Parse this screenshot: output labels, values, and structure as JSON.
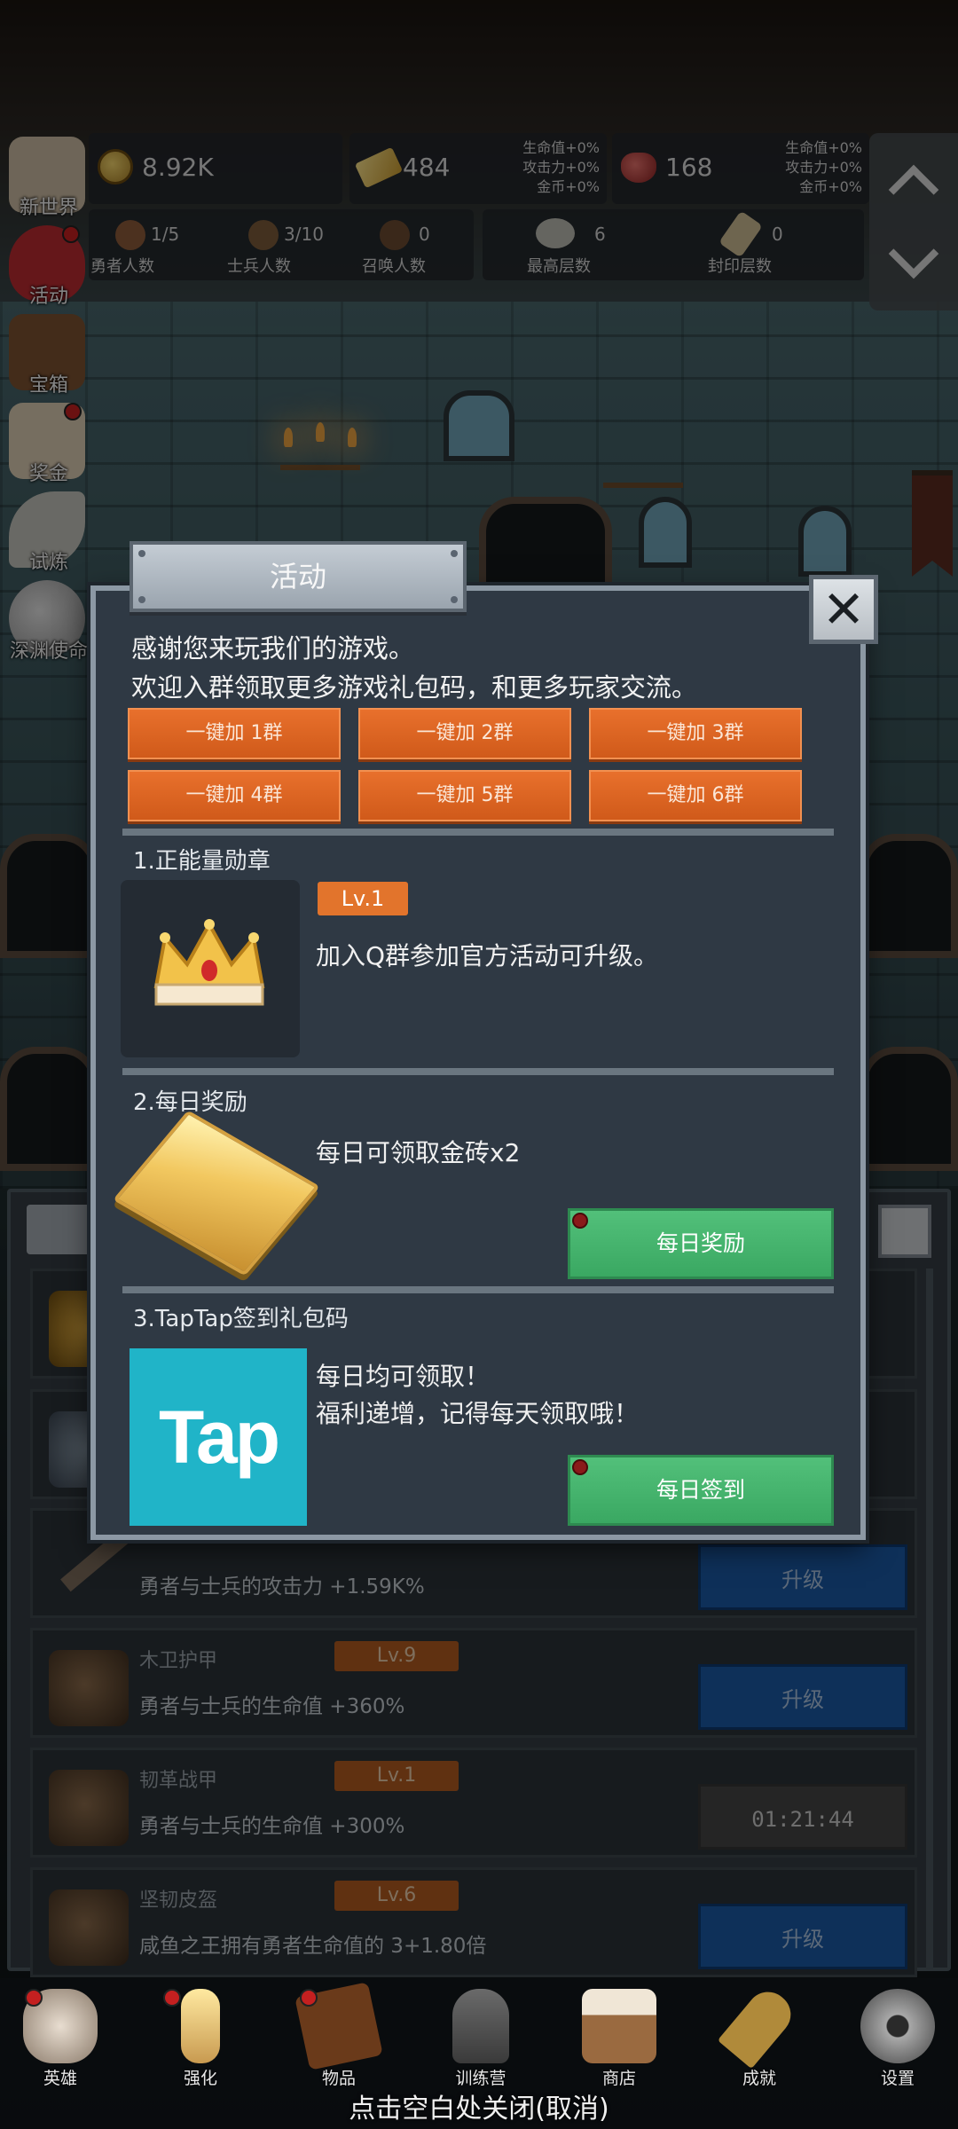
{
  "resources": {
    "gold": "8.92K",
    "goldbar": "484",
    "gem": "168",
    "goldbar_note": [
      "生命值+0%",
      "攻击力+0%",
      "金币+0%"
    ],
    "gem_note": [
      "生命值+0%",
      "攻击力+0%",
      "金币+0%"
    ]
  },
  "stats": [
    {
      "value": "1/5",
      "label": "勇者人数"
    },
    {
      "value": "3/10",
      "label": "士兵人数"
    },
    {
      "value": "0",
      "label": "召唤人数"
    },
    {
      "value": "6",
      "label": "最高层数"
    },
    {
      "value": "0",
      "label": "封印层数"
    }
  ],
  "side_menu": [
    {
      "label": "新世界",
      "icon": "map-icon",
      "dot": false
    },
    {
      "label": "活动",
      "icon": "heart-icon",
      "dot": true
    },
    {
      "label": "宝箱",
      "icon": "chest-icon",
      "dot": false
    },
    {
      "label": "奖金",
      "icon": "envelope-icon",
      "dot": true
    },
    {
      "label": "试炼",
      "icon": "wing-icon",
      "dot": false
    },
    {
      "label": "深渊使命",
      "icon": "orb-icon",
      "dot": false
    }
  ],
  "modal": {
    "title": "活动",
    "close_symbol": "✕",
    "intro_line1": "感谢您来玩我们的游戏。",
    "intro_line2": "欢迎入群领取更多游戏礼包码，和更多玩家交流。",
    "group_buttons": [
      "一键加 1群",
      "一键加 2群",
      "一键加 3群",
      "一键加 4群",
      "一键加 5群",
      "一键加 6群"
    ],
    "section1": {
      "title": "1.正能量勋章",
      "level": "Lv.1",
      "text": "加入Q群参加官方活动可升级。"
    },
    "section2": {
      "title": "2.每日奖励",
      "text": "每日可领取金砖x2",
      "button": "每日奖励"
    },
    "section3": {
      "title": "3.TapTap签到礼包码",
      "logo": "Tap",
      "text1": "每日均可领取！",
      "text2": "福利递增，记得每天领取哦！",
      "button": "每日签到"
    }
  },
  "upgrade_rows": [
    {
      "name": "",
      "level": "",
      "desc": "勇者与士兵的攻击力 +1.59K%",
      "button": "升级"
    },
    {
      "name": "木卫护甲",
      "level": "Lv.9",
      "desc": "勇者与士兵的生命值 +360%",
      "button": "升级"
    },
    {
      "name": "韧革战甲",
      "level": "Lv.1",
      "desc": "勇者与士兵的生命值 +300%",
      "button": "01:21:44"
    },
    {
      "name": "坚韧皮盔",
      "level": "Lv.6",
      "desc": "咸鱼之王拥有勇者生命值的 3+1.80倍",
      "button": "升级"
    }
  ],
  "bottom_nav": [
    {
      "label": "英雄",
      "icon": "skull-icon",
      "dot": true
    },
    {
      "label": "强化",
      "icon": "candle-icon",
      "dot": true
    },
    {
      "label": "物品",
      "icon": "book-icon",
      "dot": true
    },
    {
      "label": "训练营",
      "icon": "lantern-icon",
      "dot": false
    },
    {
      "label": "商店",
      "icon": "mug-icon",
      "dot": false
    },
    {
      "label": "成就",
      "icon": "key-icon",
      "dot": false
    },
    {
      "label": "设置",
      "icon": "gear-icon",
      "dot": false
    }
  ],
  "close_hint": "点击空白处关闭(取消)"
}
